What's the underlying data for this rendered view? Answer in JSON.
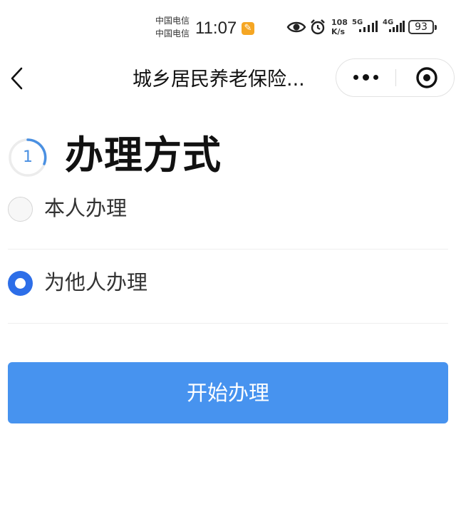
{
  "status_bar": {
    "carrier_1": "中国电信",
    "carrier_2": "中国电信",
    "time": "11:07",
    "net_speed_value": "108",
    "net_speed_unit": "K/s",
    "network_1": "5G",
    "network_2": "4G",
    "battery": "93"
  },
  "nav": {
    "title": "城乡居民养老保险..."
  },
  "step": {
    "number": "1",
    "title": "办理方式"
  },
  "options": [
    {
      "label": "本人办理",
      "selected": false
    },
    {
      "label": "为他人办理",
      "selected": true
    }
  ],
  "start_button": {
    "label": "开始办理"
  },
  "colors": {
    "primary": "#4793ef",
    "radio_selected": "#2d6ee8",
    "step_ring": "#4a90e2"
  }
}
